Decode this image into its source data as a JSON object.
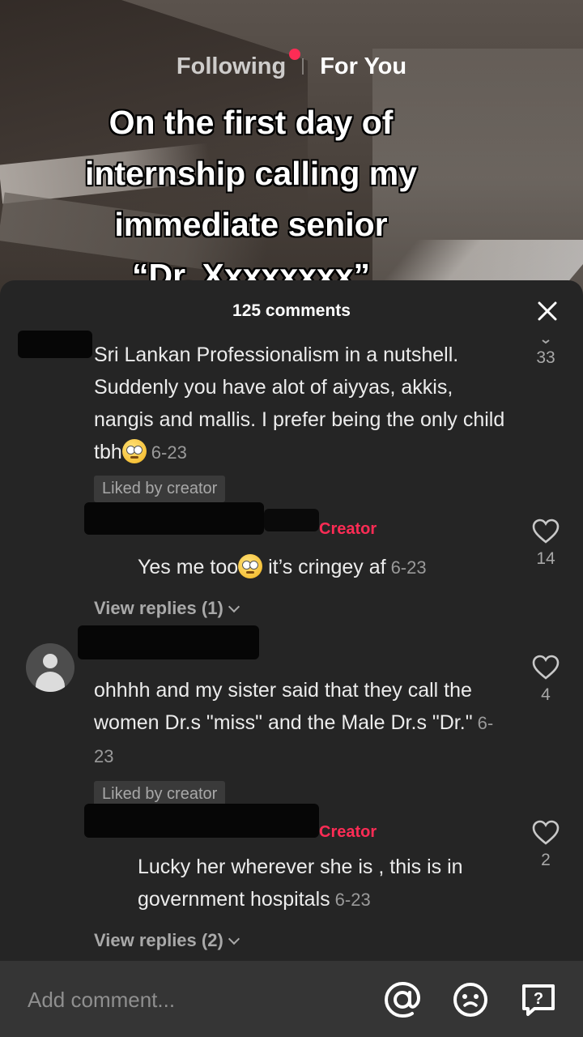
{
  "nav": {
    "following": "Following",
    "for_you": "For You"
  },
  "caption": "On the first day of\ninternship calling my\nimmediate senior\n“Dr. Xxxxxxxx”",
  "sheet": {
    "title": "125 comments",
    "close_icon": "close-icon"
  },
  "comments": [
    {
      "text": "Sri Lankan Professionalism in a nutshell. Suddenly you have alot of aiyyas, akkis, nangis and mallis. I prefer being the only child tbh",
      "emoji": "face-with-rolling-eyes",
      "date": "6-23",
      "liked_badge": "Liked by creator",
      "like_count": "33"
    },
    {
      "tag": "Creator",
      "text_before": "Yes me too",
      "emoji": "face-with-rolling-eyes",
      "text_after": " it’s cringey af",
      "date": "6-23",
      "like_count": "14"
    },
    {
      "view_replies": "View replies (1)"
    },
    {
      "text": "ohhhh and my sister said that they call the women Dr.s \"miss\" and the Male Dr.s \"Dr.\"",
      "date": "6-23",
      "liked_badge": "Liked by creator",
      "like_count": "4"
    },
    {
      "tag": "Creator",
      "text": "Lucky her wherever she is , this is in government hospitals",
      "date": "6-23",
      "like_count": "2"
    },
    {
      "view_replies": "View replies (2)"
    }
  ],
  "input": {
    "placeholder": "Add comment..."
  },
  "colors": {
    "accent": "#fe2c55",
    "sheet": "#252525",
    "inputbar": "#353535"
  }
}
